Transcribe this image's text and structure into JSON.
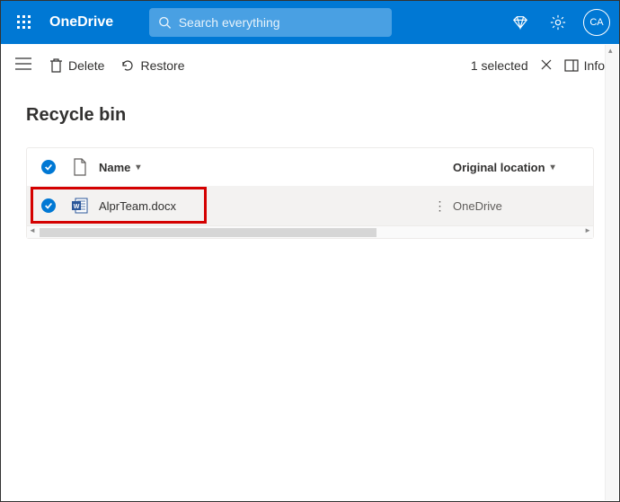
{
  "header": {
    "brand": "OneDrive",
    "search_placeholder": "Search everything",
    "avatar_initials": "CA"
  },
  "command_bar": {
    "delete_label": "Delete",
    "restore_label": "Restore",
    "selected_label": "1 selected",
    "info_label": "Info"
  },
  "page": {
    "title": "Recycle bin"
  },
  "table": {
    "headers": {
      "name": "Name",
      "location": "Original location"
    },
    "rows": [
      {
        "selected": true,
        "filename": "AlprTeam.docx",
        "location": "OneDrive"
      }
    ]
  }
}
